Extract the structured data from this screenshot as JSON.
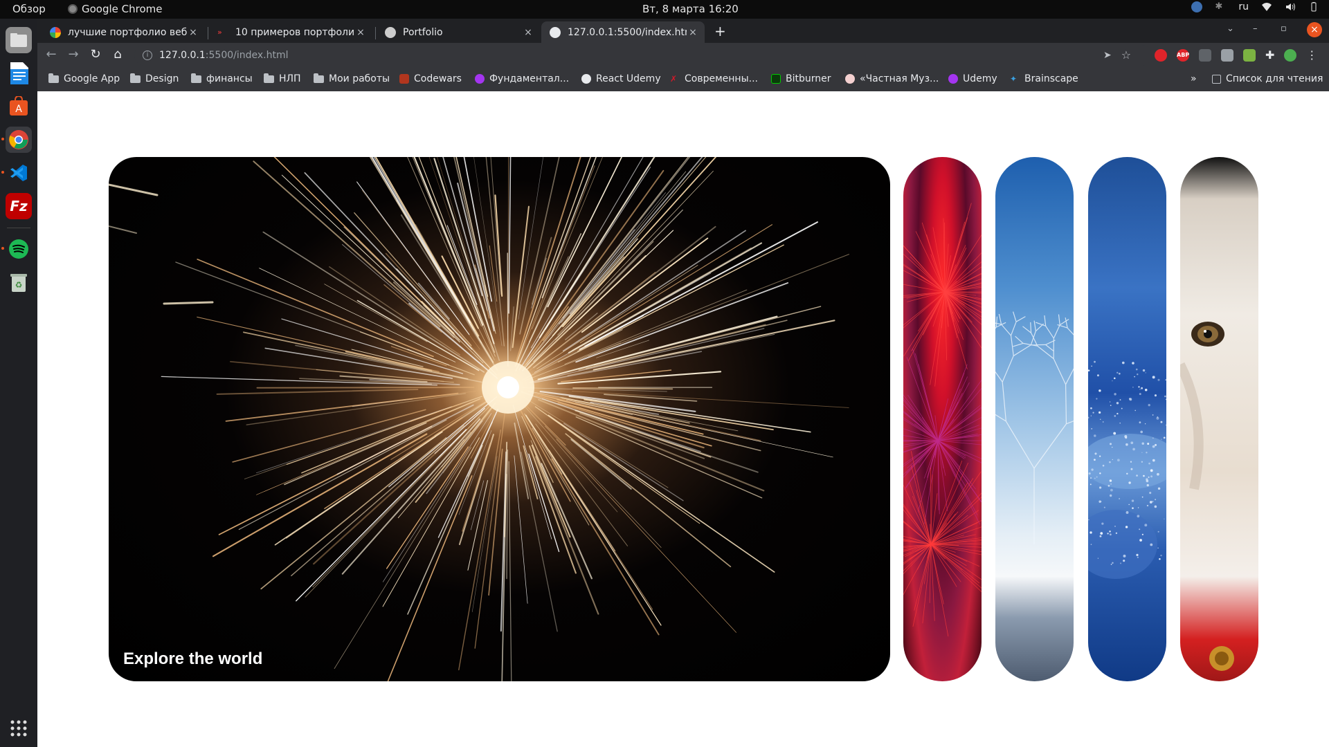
{
  "system_bar": {
    "overview": "Обзор",
    "app_name": "Google Chrome",
    "clock": "Вт, 8 марта  16:20",
    "language": "ru"
  },
  "dock": {
    "items": [
      {
        "name": "files-icon",
        "color": "#8a8a8a"
      },
      {
        "name": "libreoffice-writer-icon",
        "color": "#1e88e5"
      },
      {
        "name": "ubuntu-software-icon",
        "color": "#e95420"
      },
      {
        "name": "chrome-icon",
        "color": "#4285f4"
      },
      {
        "name": "vscode-icon",
        "color": "#0078d4"
      },
      {
        "name": "filezilla-icon",
        "color": "#bf0000"
      },
      {
        "name": "spotify-icon",
        "color": "#1db954"
      },
      {
        "name": "trash-icon",
        "color": "#7a9a7a"
      }
    ]
  },
  "browser": {
    "tabs": [
      {
        "title": "лучшие портфолио веб р",
        "favicon_color": "#ffffff",
        "active": false
      },
      {
        "title": "10 примеров портфолио",
        "favicon_color": "#ff3d3d",
        "active": false
      },
      {
        "title": "Portfolio",
        "favicon_color": "#cccccc",
        "active": false
      },
      {
        "title": "127.0.0.1:5500/index.html",
        "favicon_color": "#e8eaed",
        "active": true
      }
    ],
    "new_tab_label": "+",
    "close_label": "×",
    "url_host": "127.0.0.1",
    "url_path": ":5500/index.html",
    "bookmarks": [
      {
        "label": "Google App",
        "type": "folder"
      },
      {
        "label": "Design",
        "type": "folder"
      },
      {
        "label": "финансы",
        "type": "folder"
      },
      {
        "label": "НЛП",
        "type": "folder"
      },
      {
        "label": "Мои работы",
        "type": "folder"
      },
      {
        "label": "Codewars",
        "type": "site",
        "color": "#b1361e"
      },
      {
        "label": "Фундаментал...",
        "type": "site",
        "color": "#a435f0"
      },
      {
        "label": "React Udemy",
        "type": "site",
        "color": "#e8eaed"
      },
      {
        "label": "Современны...",
        "type": "site",
        "color": "#d11a2a"
      },
      {
        "label": "Bitburner",
        "type": "site",
        "color": "#0c0"
      },
      {
        "label": "«Частная Муз...",
        "type": "site",
        "color": "#e8a0a0"
      },
      {
        "label": "Udemy",
        "type": "site",
        "color": "#a435f0"
      },
      {
        "label": "Brainscape",
        "type": "site",
        "color": "#3aa0e0"
      }
    ],
    "more_label": "»",
    "reading_list": "Список для чтения"
  },
  "page": {
    "main_caption": "Explore the world",
    "panels": [
      {
        "name": "fireworks"
      },
      {
        "name": "frosted-tree"
      },
      {
        "name": "snow"
      },
      {
        "name": "dog"
      }
    ]
  }
}
